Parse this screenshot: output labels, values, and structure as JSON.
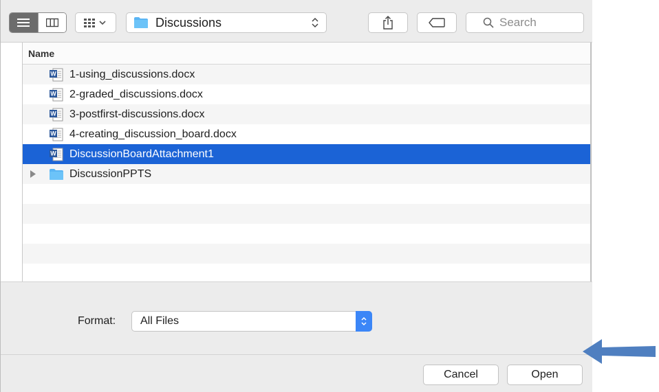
{
  "toolbar": {
    "path_label": "Discussions",
    "search_placeholder": "Search"
  },
  "list": {
    "column_header": "Name",
    "items": [
      {
        "name": "1-using_discussions.docx",
        "kind": "word-doc-icon"
      },
      {
        "name": "2-graded_discussions.docx",
        "kind": "word-doc-icon"
      },
      {
        "name": "3-postfirst-discussions.docx",
        "kind": "word-doc-icon"
      },
      {
        "name": "4-creating_discussion_board.docx",
        "kind": "word-doc-icon"
      },
      {
        "name": "DiscussionBoardAttachment1",
        "kind": "word-doc-icon",
        "selected": true
      },
      {
        "name": "DiscussionPPTS",
        "kind": "folder-icon"
      }
    ]
  },
  "format": {
    "label": "Format:",
    "value": "All Files"
  },
  "buttons": {
    "cancel": "Cancel",
    "open": "Open"
  },
  "colors": {
    "selection": "#1b63d6",
    "folder": "#5ab5f4",
    "accent": "#3b86f7",
    "arrow": "#4f7fc0"
  }
}
